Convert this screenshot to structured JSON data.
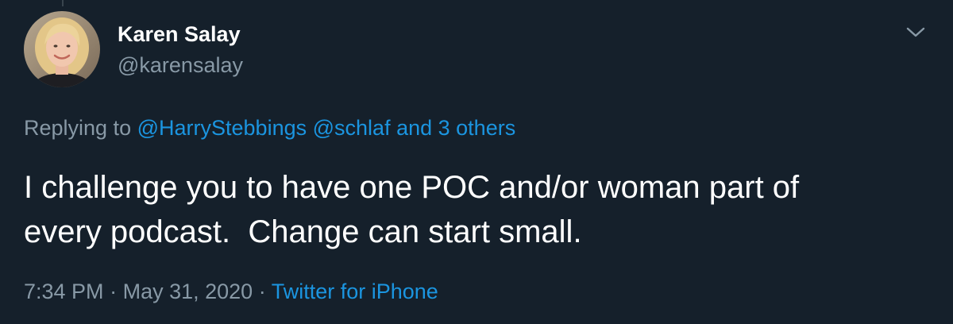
{
  "tweet": {
    "author": {
      "display_name": "Karen Salay",
      "handle": "@karensalay",
      "avatar_icon": "profile-photo"
    },
    "menu_icon": "chevron-down-icon",
    "reply": {
      "prefix": "Replying to",
      "mentions": [
        "@HarryStebbings",
        "@schlaf"
      ],
      "others": "and 3 others"
    },
    "text": "I challenge you to have one POC and/or woman part of\nevery podcast.  Change can start small.",
    "time": "7:34 PM",
    "separator": "·",
    "date": "May 31, 2020",
    "source": "Twitter for iPhone"
  },
  "colors": {
    "background": "#15202b",
    "primary_text": "#ffffff",
    "secondary_text": "#8899a6",
    "link": "#1b95e0"
  }
}
